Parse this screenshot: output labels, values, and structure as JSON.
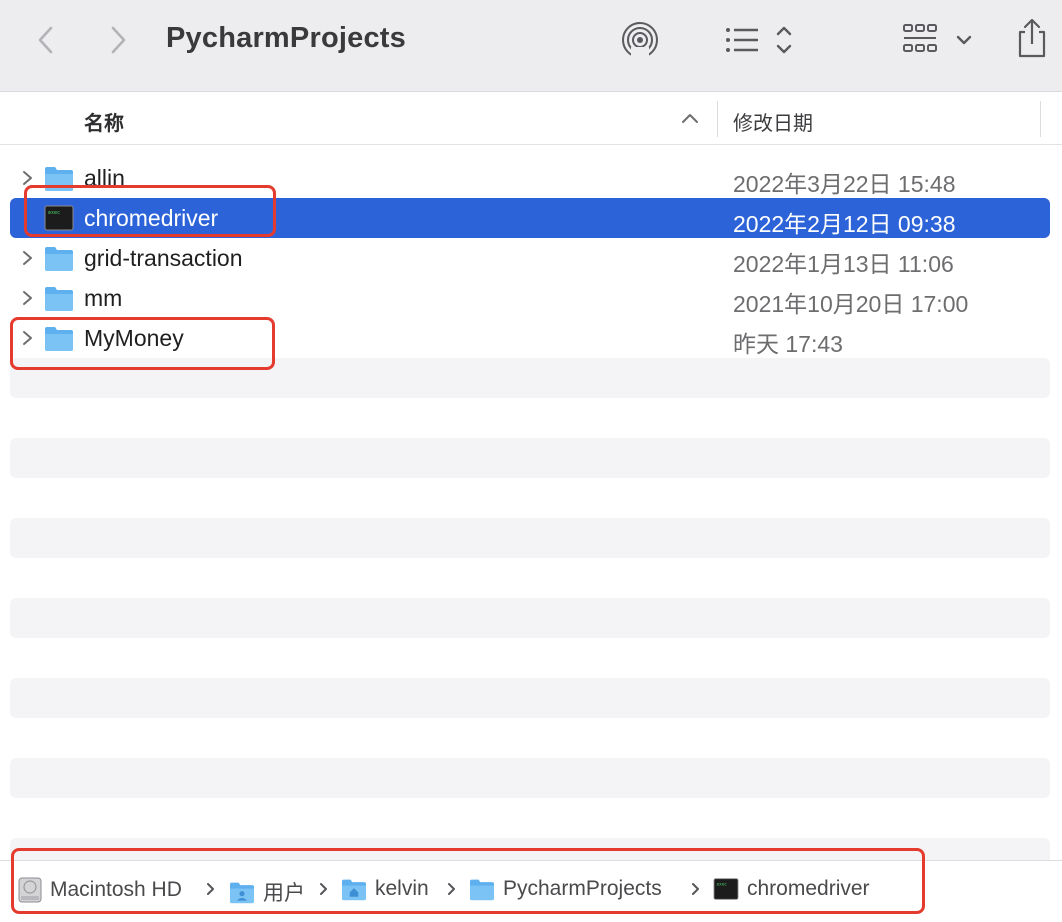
{
  "window": {
    "title": "PycharmProjects"
  },
  "toolbar": {
    "back_icon": "chevron-left-icon",
    "forward_icon": "chevron-right-icon",
    "airdrop_icon": "airdrop-icon",
    "list_view_icon": "list-icon",
    "grid_view_icon": "grid-icon",
    "share_icon": "share-icon"
  },
  "columns": {
    "name": "名称",
    "date_modified": "修改日期"
  },
  "files": [
    {
      "name": "allin",
      "date": "2022年3月22日 15:48",
      "kind": "folder",
      "expandable": true,
      "selected": false
    },
    {
      "name": "chromedriver",
      "date": "2022年2月12日 09:38",
      "kind": "executable",
      "expandable": false,
      "selected": true
    },
    {
      "name": "grid-transaction",
      "date": "2022年1月13日 11:06",
      "kind": "folder",
      "expandable": true,
      "selected": false
    },
    {
      "name": "mm",
      "date": "2021年10月20日 17:00",
      "kind": "folder",
      "expandable": true,
      "selected": false
    },
    {
      "name": "MyMoney",
      "date": "昨天 17:43",
      "kind": "folder",
      "expandable": true,
      "selected": false
    }
  ],
  "path": [
    {
      "label": "Macintosh HD",
      "icon": "hard-drive-icon"
    },
    {
      "label": "用户",
      "icon": "users-folder-icon"
    },
    {
      "label": "kelvin",
      "icon": "home-folder-icon"
    },
    {
      "label": "PycharmProjects",
      "icon": "folder-icon"
    },
    {
      "label": "chromedriver",
      "icon": "terminal-exec-icon"
    }
  ],
  "colors": {
    "selection": "#2d63d9",
    "annotation": "#e53b2f",
    "folder": "#5fb0ef"
  }
}
